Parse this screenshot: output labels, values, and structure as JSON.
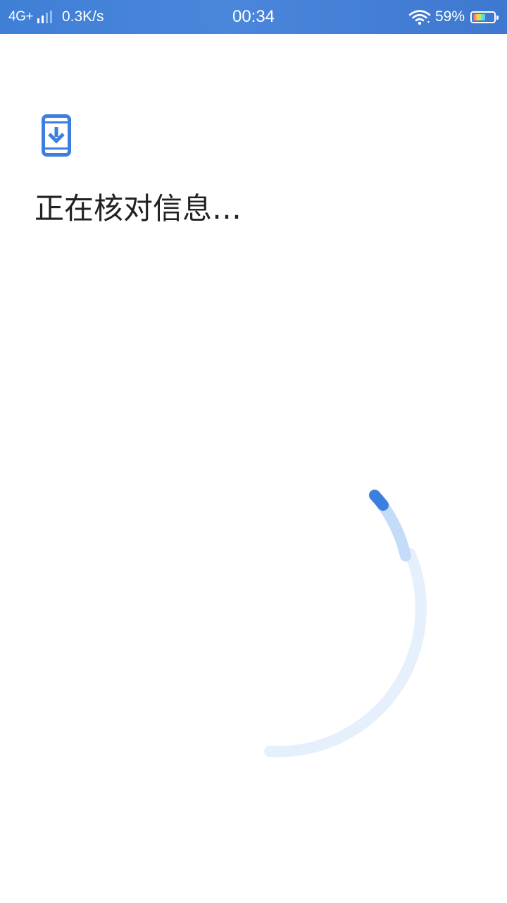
{
  "status_bar": {
    "network_type": "4G+",
    "net_speed": "0.3K/s",
    "time": "00:34",
    "battery_percent": "59%",
    "battery_level": 0.59,
    "icons": [
      "signal-icon",
      "wifi-icon",
      "battery-icon"
    ]
  },
  "main": {
    "icon": "phone-download-icon",
    "title": "正在核对信息…"
  },
  "loading": {
    "icon": "loading-spinner-icon",
    "accent_color": "#3d7fe0",
    "track_color": "#e6effc"
  },
  "colors": {
    "status_bar_bg": "#4a86db",
    "accent": "#3d7fe0",
    "text": "#222222",
    "background": "#ffffff"
  }
}
